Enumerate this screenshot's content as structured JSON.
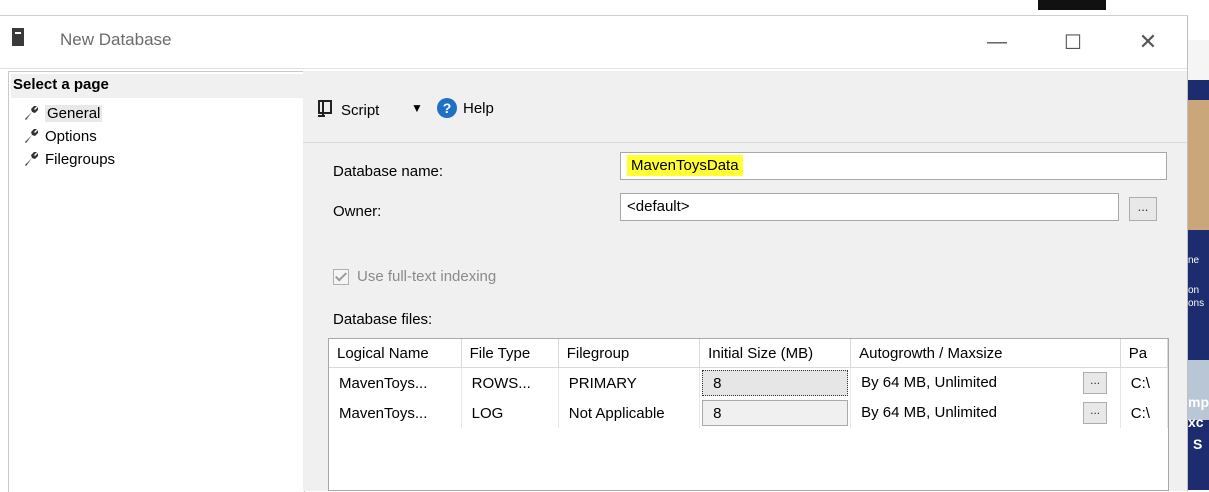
{
  "window": {
    "title": "New Database",
    "min_glyph": "—",
    "max_glyph": "☐",
    "close_glyph": "✕"
  },
  "left_panel": {
    "header": "Select a page",
    "items": [
      {
        "label": "General",
        "icon": "wrench-icon",
        "selected": true
      },
      {
        "label": "Options",
        "icon": "wrench-icon",
        "selected": false
      },
      {
        "label": "Filegroups",
        "icon": "wrench-icon",
        "selected": false
      }
    ]
  },
  "toolbar": {
    "script_label": "Script",
    "dropdown_glyph": "▼",
    "help_glyph": "?",
    "help_label": "Help"
  },
  "form": {
    "db_name_label": "Database name:",
    "db_name_value": "MavenToysData",
    "owner_label": "Owner:",
    "owner_value": "<default>",
    "owner_browse": "...",
    "fulltext_label": "Use full-text indexing",
    "db_files_label": "Database files:"
  },
  "files_table": {
    "columns": [
      "Logical Name",
      "File Type",
      "Filegroup",
      "Initial Size (MB)",
      "Autogrowth / Maxsize",
      "Pa"
    ],
    "rows": [
      {
        "logical_name": "MavenToys...",
        "file_type": "ROWS...",
        "filegroup": "PRIMARY",
        "initial_size": "8",
        "autogrowth": "By 64 MB, Unlimited",
        "btn": "...",
        "path": "C:\\"
      },
      {
        "logical_name": "MavenToys...",
        "file_type": "LOG",
        "filegroup": "Not Applicable",
        "initial_size": "8",
        "autogrowth": "By 64 MB, Unlimited",
        "btn": "...",
        "path": "C:\\"
      }
    ]
  },
  "background_strip": {
    "lines1": [
      "ne",
      "on",
      "ons"
    ],
    "lines2": [
      "mp",
      "xc",
      "S"
    ]
  },
  "colors": {
    "highlight": "#ffff33",
    "help_blue": "#1f6fc5",
    "panel_gray": "#f0f0f0"
  }
}
